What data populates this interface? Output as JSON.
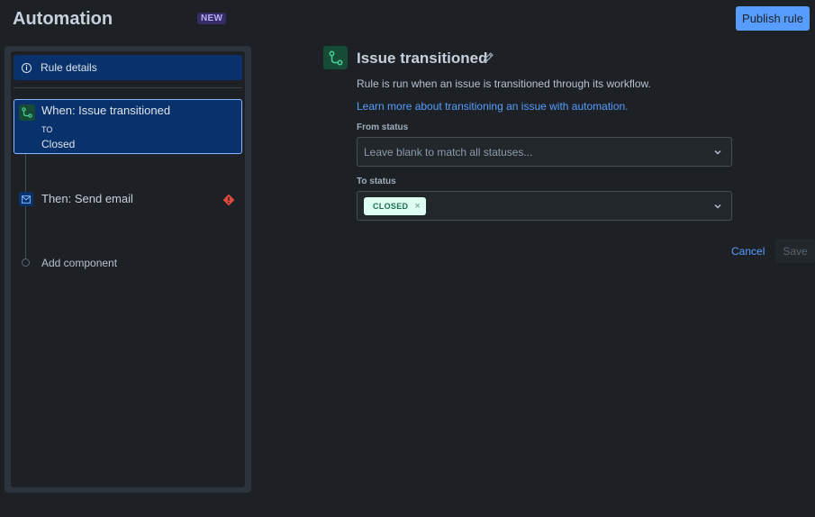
{
  "header": {
    "title": "Automation",
    "badge": "NEW",
    "publish_label": "Publish rule"
  },
  "sidebar": {
    "rule_details": {
      "label": "Rule details",
      "icon": "info-icon"
    },
    "trigger": {
      "title": "When: Issue transitioned",
      "to_label": "TO",
      "value": "Closed",
      "icon": "transition-icon"
    },
    "action": {
      "title": "Then: Send email",
      "icon": "email-icon",
      "status_icon": "error-icon"
    },
    "add_component_label": "Add component"
  },
  "main": {
    "icon": "transition-icon",
    "title": "Issue transitioned",
    "description": "Rule is run when an issue is transitioned through its workflow.",
    "learn_more": "Learn more about transitioning an issue with automation.",
    "from_status": {
      "label": "From status",
      "placeholder": "Leave blank to match all statuses..."
    },
    "to_status": {
      "label": "To status",
      "selected": [
        "CLOSED"
      ],
      "remove_glyph": "×"
    },
    "cancel_label": "Cancel",
    "save_label": "Save"
  },
  "colors": {
    "background": "#1d2125",
    "accent": "#579dff",
    "selected": "#09326c",
    "success_lozenge": "#dcfff1",
    "error": "#e2483d"
  }
}
